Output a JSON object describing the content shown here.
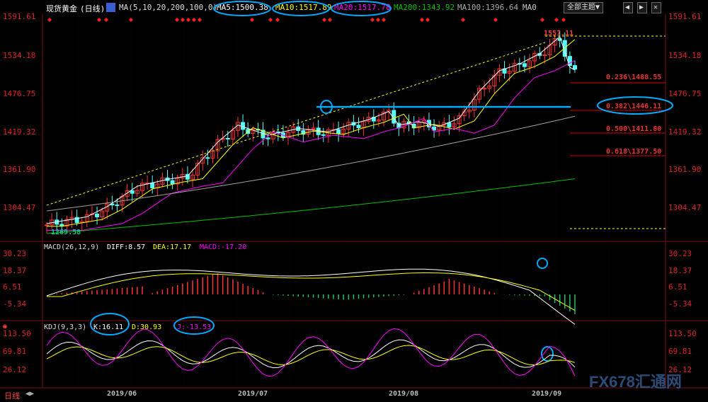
{
  "header": {
    "instrument": "现货黄金",
    "period": "(日线)",
    "ma_params": "MA(5,10,20,200,100,0)",
    "ma5": "MA5:1500.38",
    "ma10": "MA10:1517.89",
    "ma20": "MA20:1517.78",
    "ma200": "MA200:1343.92",
    "ma100": "MA100:1396.64",
    "ma0": "MA0",
    "theme_button": "全部主题▼"
  },
  "price_axis": [
    "1591.61",
    "1534.18",
    "1476.75",
    "1419.32",
    "1361.90",
    "1304.47"
  ],
  "price_annotations": {
    "high": "1557.11",
    "low": "1269.58"
  },
  "fib_levels": [
    "0.236\\1488.55",
    "0.382\\1446.11",
    "0.500\\1411.80",
    "0.618\\1377.50"
  ],
  "macd": {
    "title": "MACD(26,12,9)",
    "diff": "DIFF:8.57",
    "dea": "DEA:17.17",
    "macd": "MACD:-17.20",
    "axis": [
      "30.23",
      "18.37",
      "6.51",
      "-5.34"
    ]
  },
  "kdj": {
    "title": "KDJ(9,3,3)",
    "k": "K:16.11",
    "d": "D:30.93",
    "j": "J:-13.53",
    "axis": [
      "113.50",
      "69.81",
      "26.12"
    ]
  },
  "months": [
    "2019/06",
    "2019/07",
    "2019/08",
    "2019/09"
  ],
  "bottom_tab": "日线",
  "watermark": "FX678汇通网",
  "colors": {
    "up": "#ff3232",
    "down": "#54ffff",
    "ma5": "#ffffff",
    "ma10": "#ffff00",
    "ma20": "#ff00ff",
    "ma200": "#00c000",
    "ma100": "#a0a0a0",
    "highlight": "#00aaff"
  }
}
